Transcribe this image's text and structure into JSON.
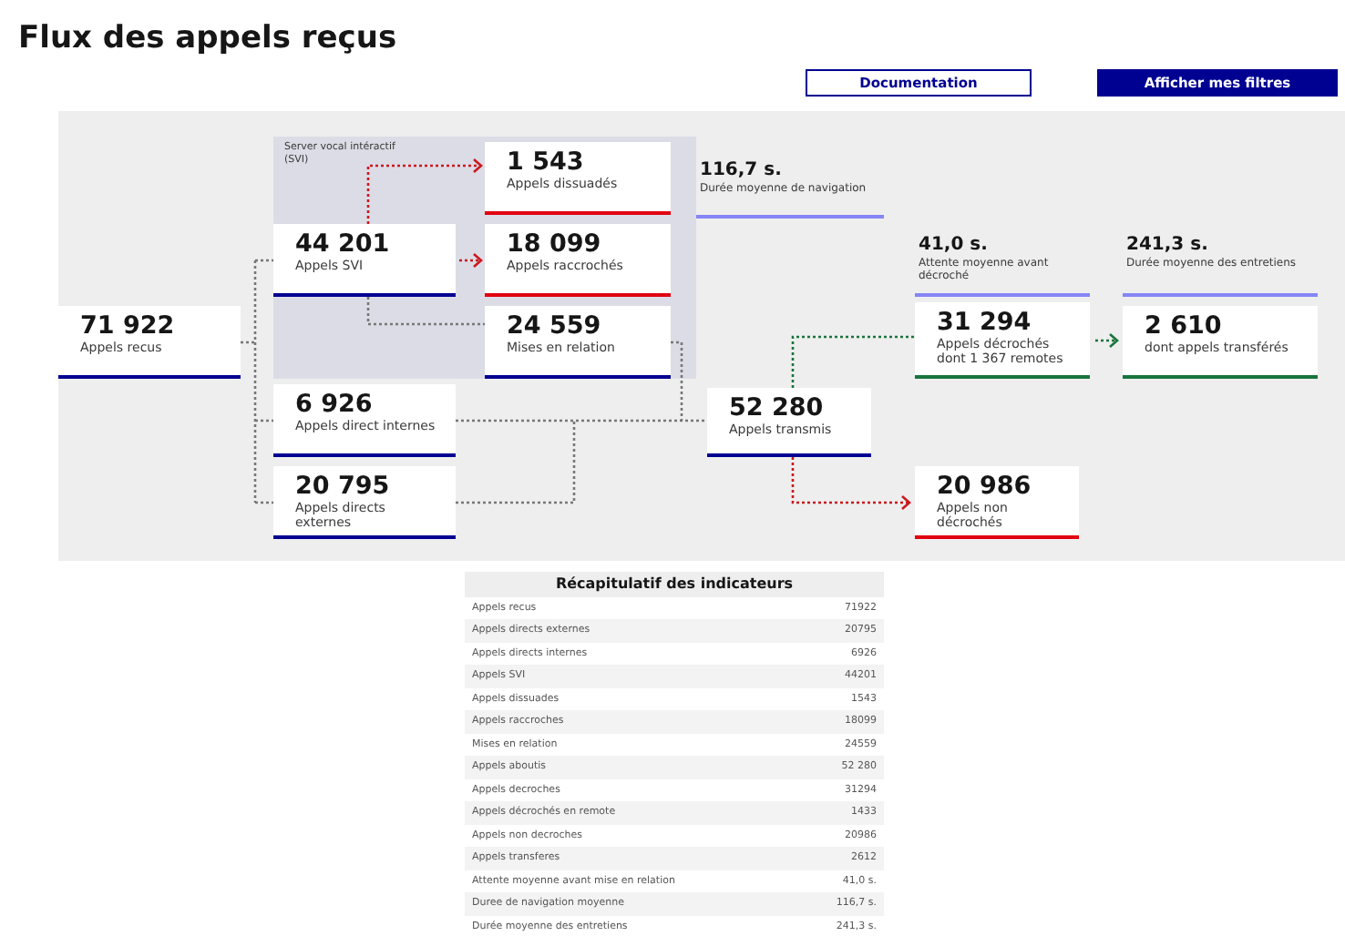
{
  "page": {
    "title": "Flux des appels reçus"
  },
  "buttons": [
    {
      "label": "Documentation",
      "kind": "outline"
    },
    {
      "label": "Afficher mes filtres",
      "kind": "primary"
    }
  ],
  "diagram": {
    "group_label": "Server vocal intéractif (SVI)",
    "nodes": [
      {
        "kind": "box",
        "value": "71 922",
        "label": "Appels recus",
        "color": "#000091"
      },
      {
        "kind": "box",
        "value": "44 201",
        "label": "Appels SVI",
        "color": "#000091"
      },
      {
        "kind": "box",
        "value": "1 543",
        "label": "Appels dissuadés",
        "color": "#e1000f"
      },
      {
        "kind": "box",
        "value": "18 099",
        "label": "Appels raccrochés",
        "color": "#e1000f"
      },
      {
        "kind": "box",
        "value": "24 559",
        "label": "Mises en relation",
        "color": "#000091"
      },
      {
        "kind": "box",
        "value": "6 926",
        "label": "Appels direct internes",
        "color": "#000091"
      },
      {
        "kind": "box",
        "value": "20 795",
        "label": "Appels directs externes",
        "color": "#000091"
      },
      {
        "kind": "metric",
        "value": "116,7 s.",
        "label": "Durée moyenne de navigation",
        "color": "#8585f6"
      },
      {
        "kind": "metric",
        "value": "41,0 s.",
        "label": "Attente moyenne avant décroché",
        "color": "#8585f6"
      },
      {
        "kind": "metric",
        "value": "241,3 s.",
        "label": "Durée moyenne des entretiens",
        "color": "#8585f6"
      },
      {
        "kind": "box",
        "value": "31 294",
        "label": "Appels décrochés dont 1 367 remotes",
        "color": "#18753c"
      },
      {
        "kind": "box",
        "value": "2 610",
        "label": "dont appels transférés",
        "color": "#18753c"
      },
      {
        "kind": "box",
        "value": "52 280",
        "label": "Appels transmis",
        "color": "#000091"
      },
      {
        "kind": "box",
        "value": "20 986",
        "label": "Appels non décrochés",
        "color": "#e1000f"
      }
    ]
  },
  "summary": {
    "title": "Récapitulatif des indicateurs",
    "rows": [
      {
        "label": "Appels recus",
        "value": "71922"
      },
      {
        "label": "Appels directs externes",
        "value": "20795"
      },
      {
        "label": "Appels directs internes",
        "value": "6926"
      },
      {
        "label": "Appels SVI",
        "value": "44201"
      },
      {
        "label": "Appels dissuades",
        "value": "1543"
      },
      {
        "label": "Appels raccroches",
        "value": "18099"
      },
      {
        "label": "Mises en relation",
        "value": "24559"
      },
      {
        "label": "Appels aboutis",
        "value": "52 280"
      },
      {
        "label": "Appels decroches",
        "value": "31294"
      },
      {
        "label": "Appels décrochés en remote",
        "value": "1433"
      },
      {
        "label": "Appels non decroches",
        "value": "20986"
      },
      {
        "label": "Appels transferes",
        "value": "2612"
      },
      {
        "label": "Attente moyenne avant mise en relation",
        "value": "41,0 s."
      },
      {
        "label": "Duree de navigation moyenne",
        "value": "116,7 s."
      },
      {
        "label": "Durée moyenne des entretiens",
        "value": "241,3 s."
      }
    ]
  }
}
